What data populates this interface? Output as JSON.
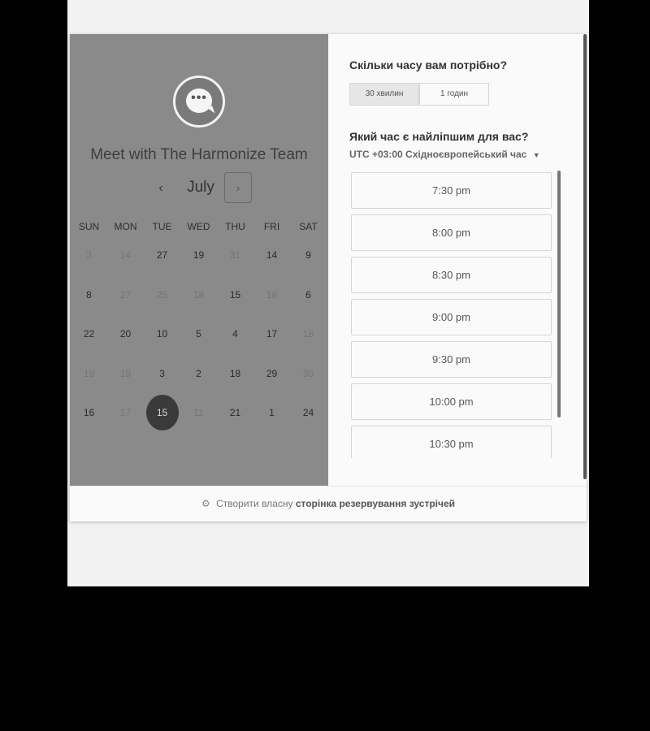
{
  "calendar": {
    "team_title": "Meet with The Harmonize Team",
    "avatar_glyph": "•••",
    "prev_label": "‹",
    "next_label": "›",
    "month": "July",
    "weekdays": [
      "SUN",
      "MON",
      "TUE",
      "WED",
      "THU",
      "FRI",
      "SAT"
    ],
    "weeks": [
      [
        {
          "d": "3",
          "dim": true
        },
        {
          "d": "14",
          "dim": true
        },
        {
          "d": "27",
          "dim": false
        },
        {
          "d": "19",
          "dim": false
        },
        {
          "d": "31",
          "dim": true
        },
        {
          "d": "14",
          "dim": false
        },
        {
          "d": "9",
          "dim": false
        }
      ],
      [
        {
          "d": "8",
          "dim": false
        },
        {
          "d": "27",
          "dim": true
        },
        {
          "d": "25",
          "dim": true
        },
        {
          "d": "18",
          "dim": true
        },
        {
          "d": "15",
          "dim": false
        },
        {
          "d": "18",
          "dim": true
        },
        {
          "d": "6",
          "dim": false
        }
      ],
      [
        {
          "d": "22",
          "dim": false
        },
        {
          "d": "20",
          "dim": false
        },
        {
          "d": "10",
          "dim": false
        },
        {
          "d": "5",
          "dim": false
        },
        {
          "d": "4",
          "dim": false
        },
        {
          "d": "17",
          "dim": false
        },
        {
          "d": "18",
          "dim": true
        }
      ],
      [
        {
          "d": "19",
          "dim": true
        },
        {
          "d": "19",
          "dim": true
        },
        {
          "d": "3",
          "dim": false
        },
        {
          "d": "2",
          "dim": false
        },
        {
          "d": "18",
          "dim": false
        },
        {
          "d": "29",
          "dim": false
        },
        {
          "d": "30",
          "dim": true
        }
      ],
      [
        {
          "d": "16",
          "dim": false
        },
        {
          "d": "17",
          "dim": true
        },
        {
          "d": "15",
          "dim": false,
          "selected": true
        },
        {
          "d": "11",
          "dim": true
        },
        {
          "d": "21",
          "dim": false
        },
        {
          "d": "1",
          "dim": false
        },
        {
          "d": "24",
          "dim": false
        }
      ]
    ]
  },
  "booking": {
    "duration_question": "Скільки часу вам потрібно?",
    "durations": [
      {
        "label": "30 хвилин",
        "active": true
      },
      {
        "label": "1 годин",
        "active": false
      }
    ],
    "time_question": "Який час є найліпшим для вас?",
    "timezone_offset": "UTC +03:00",
    "timezone_name": "Східноєвропейський час",
    "slots": [
      "7:30 pm",
      "8:00 pm",
      "8:30 pm",
      "9:00 pm",
      "9:30 pm",
      "10:00 pm",
      "10:30 pm"
    ]
  },
  "footer": {
    "icon": "sprocket-icon",
    "prefix": "Створити власну",
    "link": "сторінка резервування зустрічей"
  }
}
